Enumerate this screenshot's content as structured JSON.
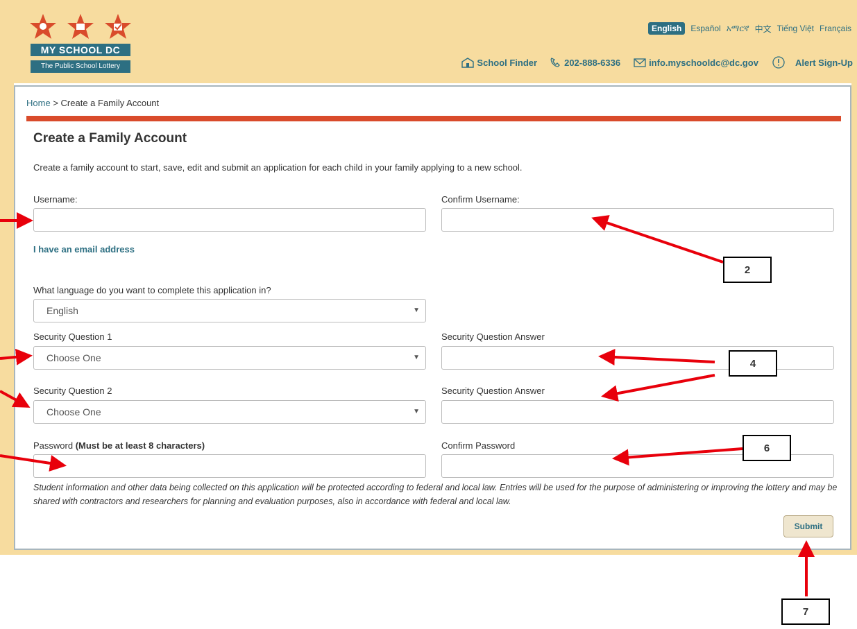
{
  "logo": {
    "title": "MY SCHOOL DC",
    "subtitle": "The Public School Lottery"
  },
  "languages": [
    "English",
    "Español",
    "አማርኛ",
    "中文",
    "Tiếng Việt",
    "Français"
  ],
  "utility": {
    "school_finder": "School Finder",
    "phone": "202-888-6336",
    "email": "info.myschooldc@dc.gov",
    "alert": "Alert Sign-Up"
  },
  "breadcrumb": {
    "home": "Home",
    "separator": ">",
    "current": "Create a Family Account"
  },
  "form": {
    "title": "Create a Family Account",
    "intro": "Create a family account to start, save, edit and submit an application for each child in your family applying to a new school.",
    "username_label": "Username:",
    "confirm_username_label": "Confirm Username:",
    "email_link": "I have an email address",
    "language_question": "What language do you want to complete this application in?",
    "language_value": "English",
    "security_q1_label": "Security Question 1",
    "security_q1_value": "Choose One",
    "security_q2_label": "Security Question 2",
    "security_q2_value": "Choose One",
    "security_answer_label": "Security Question Answer",
    "password_label": "Password ",
    "password_hint": "(Must be at least 8 characters)",
    "confirm_password_label": "Confirm Password",
    "disclaimer": "Student information and other data being collected on this application will be protected according to federal and local law. Entries will be used for the purpose of administering or improving the lottery and may be shared with contractors and researchers for planning and evaluation purposes, also in accordance with federal and local law.",
    "submit": "Submit"
  },
  "callouts": {
    "c2": "2",
    "c4": "4",
    "c6": "6",
    "c7": "7"
  },
  "colors": {
    "header_bg": "#f7dc9f",
    "brand": "#2d6f82",
    "accent_red": "#d94b2b",
    "arrow": "#e8000b"
  }
}
